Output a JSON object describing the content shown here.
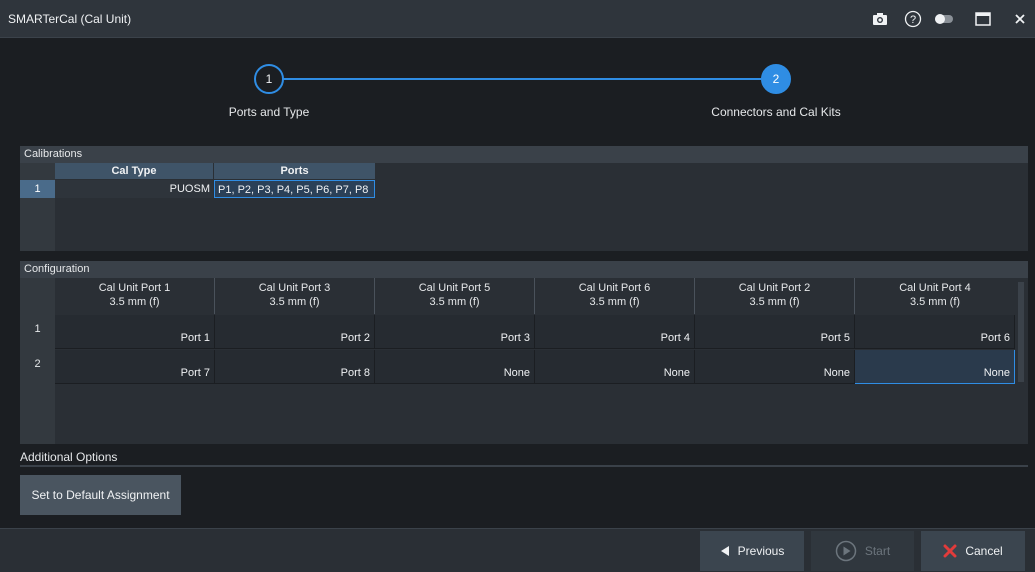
{
  "window": {
    "title": "SMARTerCal (Cal Unit)",
    "icons": [
      "camera-icon",
      "help-icon",
      "toggle-icon",
      "maximize-icon",
      "close-icon"
    ]
  },
  "wizard": {
    "steps": [
      {
        "number": "1",
        "label": "Ports and Type"
      },
      {
        "number": "2",
        "label": "Connectors and Cal Kits"
      }
    ],
    "current_step": 2,
    "accent": "#2f8de4"
  },
  "calibrations": {
    "title": "Calibrations",
    "headers": [
      "Cal Type",
      "Ports"
    ],
    "rows": [
      {
        "num": "1",
        "cal_type": "PUOSM",
        "ports": "P1, P2, P3, P4, P5, P6, P7, P8"
      }
    ]
  },
  "configuration": {
    "title": "Configuration",
    "headers": [
      {
        "name": "Cal Unit Port 1",
        "connector": "3.5 mm (f)"
      },
      {
        "name": "Cal Unit Port 3",
        "connector": "3.5 mm (f)"
      },
      {
        "name": "Cal Unit Port 5",
        "connector": "3.5 mm (f)"
      },
      {
        "name": "Cal Unit Port 6",
        "connector": "3.5 mm (f)"
      },
      {
        "name": "Cal Unit Port 2",
        "connector": "3.5 mm (f)"
      },
      {
        "name": "Cal Unit Port 4",
        "connector": "3.5 mm (f)"
      }
    ],
    "rows": [
      {
        "num": "1",
        "cells": [
          "Port 1",
          "Port 2",
          "Port 3",
          "Port 4",
          "Port 5",
          "Port 6"
        ]
      },
      {
        "num": "2",
        "cells": [
          "Port 7",
          "Port 8",
          "None",
          "None",
          "None",
          "None"
        ]
      }
    ]
  },
  "additional_options": {
    "title": "Additional Options",
    "default_button": "Set to Default Assignment"
  },
  "footer": {
    "previous": "Previous",
    "start": "Start",
    "cancel": "Cancel",
    "start_enabled": false,
    "cancel_icon_color": "#e23b3b"
  }
}
